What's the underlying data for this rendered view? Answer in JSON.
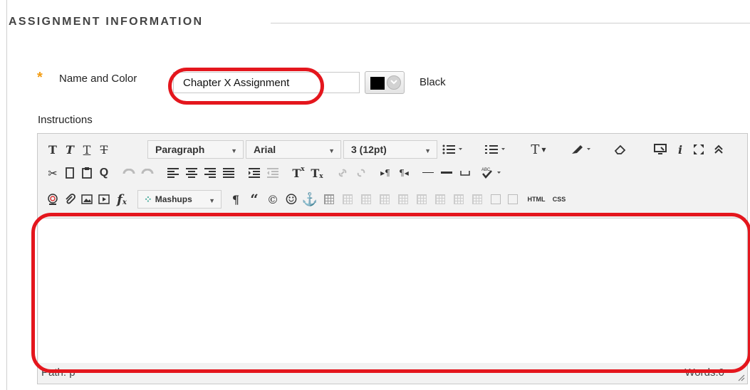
{
  "section": {
    "title": "ASSIGNMENT INFORMATION"
  },
  "name_row": {
    "required_marker": "*",
    "label": "Name and Color",
    "name_value": "Chapter X Assignment",
    "color_name": "Black",
    "swatch_color": "#000000"
  },
  "instructions": {
    "label": "Instructions"
  },
  "toolbar": {
    "row1": {
      "bold": "T",
      "italic": "T",
      "underline": "T",
      "strikethrough": "T",
      "format": "Paragraph",
      "font": "Arial",
      "size": "3 (12pt)",
      "text_color": "T",
      "preview": "⧉",
      "info": "i",
      "fullscreen": "⛶",
      "collapse": "⌃"
    },
    "row2": {
      "cut": "✂",
      "copy": "❐",
      "paste": "📋",
      "find": "Q",
      "superscript": "T",
      "subscript": "T"
    },
    "row3": {
      "mashups": "Mashups",
      "paragraph": "¶",
      "quote": "“",
      "copyright": "©",
      "emoticon": "☺",
      "anchor": "⚓",
      "html": "HTML",
      "css": "CSS",
      "math": "f"
    }
  },
  "status": {
    "path": "Path: p",
    "words": "Words:0"
  },
  "colors": {
    "annotation": "#e4161d",
    "required": "#f39c12"
  }
}
